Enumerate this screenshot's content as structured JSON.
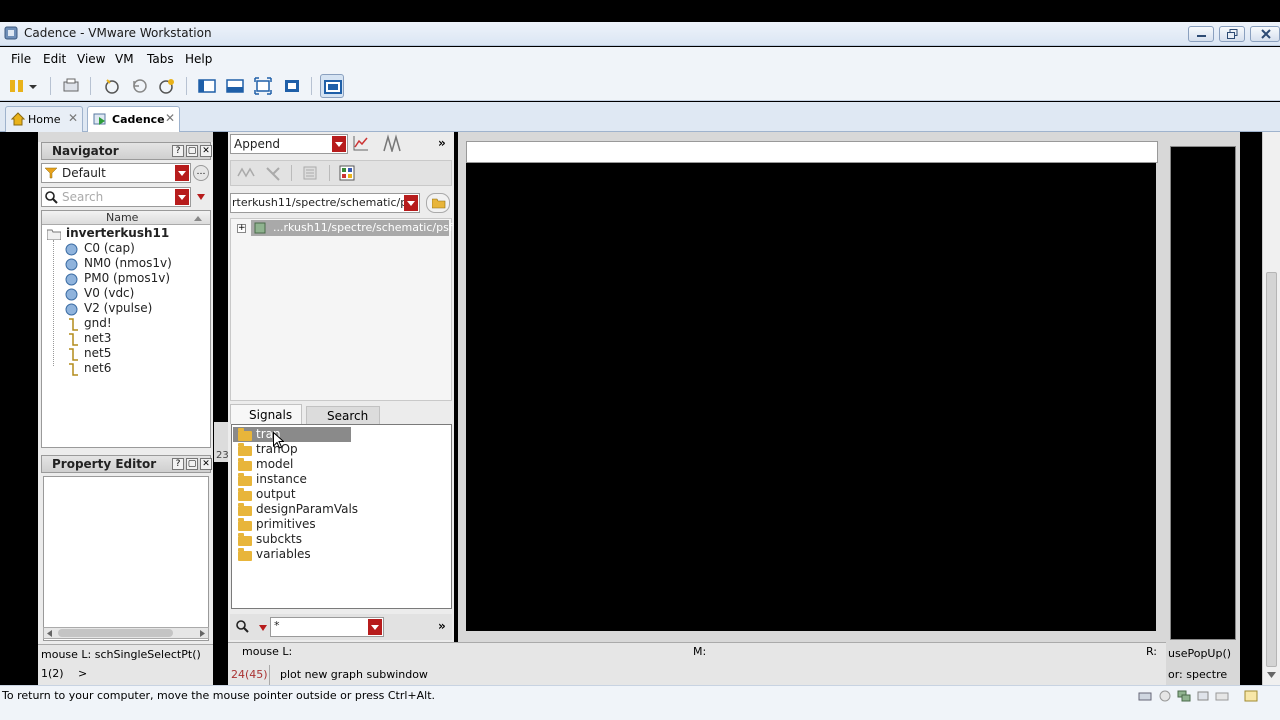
{
  "window": {
    "title": "Cadence - VMware Workstation"
  },
  "menu": [
    "File",
    "Edit",
    "View",
    "VM",
    "Tabs",
    "Help"
  ],
  "tabs": [
    {
      "label": "Home",
      "icon": "home-icon"
    },
    {
      "label": "Cadence",
      "icon": "vm-play-icon"
    }
  ],
  "navigator": {
    "title": "Navigator",
    "filter": "Default",
    "search_placeholder": "Search",
    "column": "Name",
    "root": "inverterkush11",
    "items": [
      "C0 (cap)",
      "NM0 (nmos1v)",
      "PM0 (pmos1v)",
      "V0 (vdc)",
      "V2 (vpulse)",
      "gnd!",
      "net3",
      "net5",
      "net6"
    ]
  },
  "property_editor": {
    "title": "Property Editor"
  },
  "schematic_status": {
    "mouse": "mouse L: schSingleSelectPt()",
    "counter": "1(2)",
    "prompt": ">"
  },
  "browser": {
    "mode": "Append",
    "path": "rterkush11/spectre/schematic/psf",
    "tree_item": "...rkush11/spectre/schematic/psf",
    "tabs": [
      "Signals",
      "Search"
    ],
    "signals": [
      "tran",
      "tranOp",
      "model",
      "instance",
      "output",
      "designParamVals",
      "primitives",
      "subckts",
      "variables"
    ],
    "filter_value": "*"
  },
  "side_fragment": "23",
  "viewer_status": {
    "mouse": "mouse L:",
    "middle": "M:",
    "right": "R:",
    "counter": "24(45)",
    "message": "plot new graph subwindow"
  },
  "right_fragments": {
    "popup": "usePopUp()",
    "mode": "or: spectre"
  },
  "vm_status": "To return to your computer, move the mouse pointer outside or press Ctrl+Alt."
}
